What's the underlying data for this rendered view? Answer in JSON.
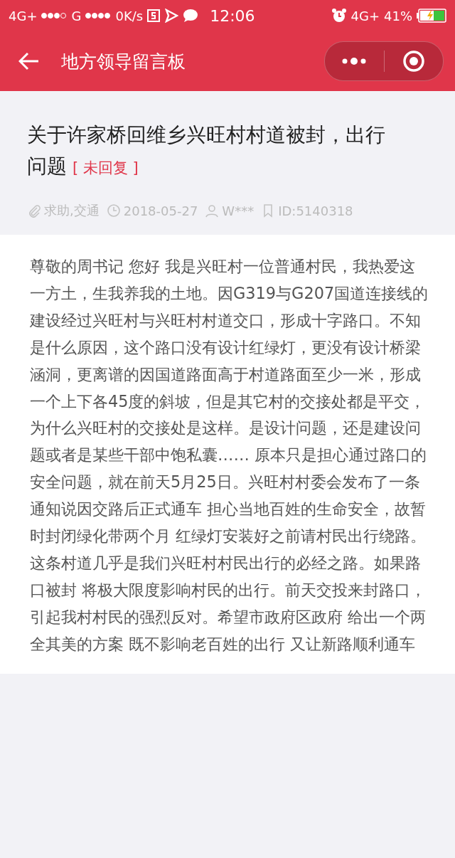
{
  "status_bar": {
    "network_1": "4G+",
    "carrier_2": "G",
    "speed": "0K/s",
    "time": "12:06",
    "network_right": "4G+",
    "battery": "41%"
  },
  "nav_bar": {
    "title": "地方领导留言板"
  },
  "post": {
    "title": "关于许家桥回维乡兴旺村村道被封，出行问题",
    "status": "[ 未回复 ]",
    "meta": [
      {
        "kind": "tags",
        "text": "求助,交通"
      },
      {
        "kind": "date",
        "text": "2018-05-27"
      },
      {
        "kind": "author",
        "text": "W***"
      },
      {
        "kind": "id",
        "text": "ID:5140318"
      }
    ],
    "body": "尊敬的周书记 您好 我是兴旺村一位普通村民，我热爱这一方土，生我养我的土地。因G319与G207国道连接线的建设经过兴旺村与兴旺村村道交口，形成十字路口。不知是什么原因，这个路口没有设计红绿灯，更没有设计桥梁涵洞，更离谱的因国道路面高于村道路面至少一米，形成一个上下各45度的斜坡，但是其它村的交接处都是平交，为什么兴旺村的交接处是这样。是设计问题，还是建设问题或者是某些干部中饱私囊…… 原本只是担心通过路口的安全问题，就在前天5月25日。兴旺村村委会发布了一条通知说因交路后正式通车 担心当地百姓的生命安全，故暂时封闭绿化带两个月 红绿灯安装好之前请村民出行绕路。这条村道几乎是我们兴旺村村民出行的必经之路。如果路口被封 将极大限度影响村民的出行。前天交投来封路口，引起我村村民的强烈反对。希望市政府区政府 给出一个两全其美的方案 既不影响老百姓的出行 又让新路顺利通车"
  }
}
